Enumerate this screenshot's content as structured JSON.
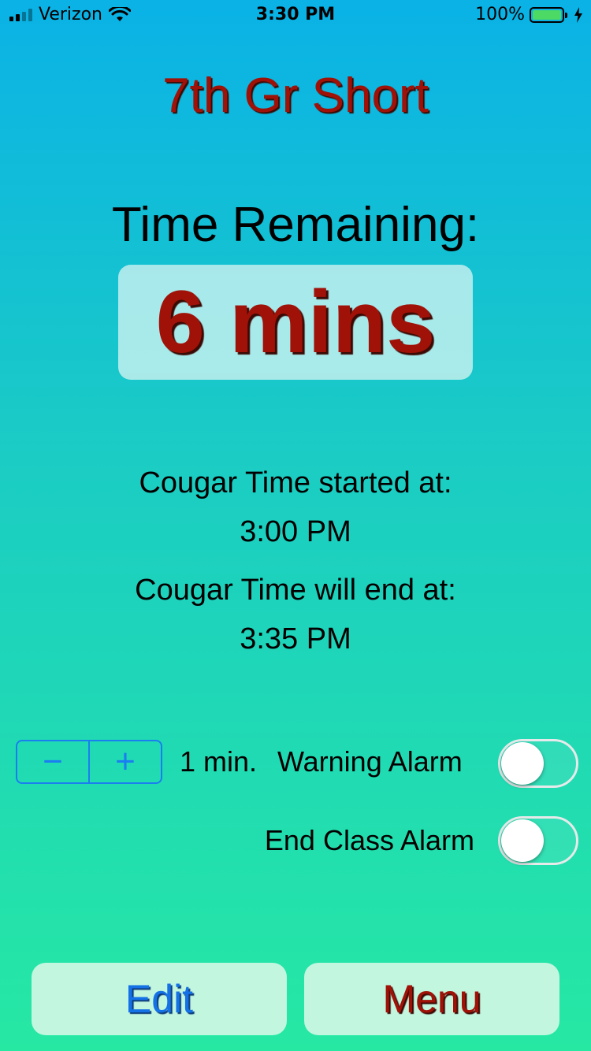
{
  "status_bar": {
    "carrier": "Verizon",
    "time": "3:30 PM",
    "battery": "100%",
    "icons": [
      "signal-icon",
      "wifi-icon",
      "battery-icon",
      "charging-icon"
    ]
  },
  "title": "7th Gr Short",
  "time_remaining": {
    "label": "Time Remaining:",
    "value": "6 mins"
  },
  "schedule": {
    "started_label": "Cougar Time started at:",
    "started_time": "3:00 PM",
    "end_label": "Cougar Time will end at:",
    "end_time": "3:35 PM"
  },
  "alarms": {
    "stepper_minus": "−",
    "stepper_plus": "+",
    "warning_minutes": "1 min.",
    "warning_label": "Warning Alarm",
    "warning_on": false,
    "end_label": "End Class Alarm",
    "end_on": false
  },
  "buttons": {
    "edit": "Edit",
    "menu": "Menu"
  },
  "colors": {
    "title_red": "#a01208",
    "accent_blue": "#1a7ef0",
    "button_bg": "#c2f6df"
  }
}
